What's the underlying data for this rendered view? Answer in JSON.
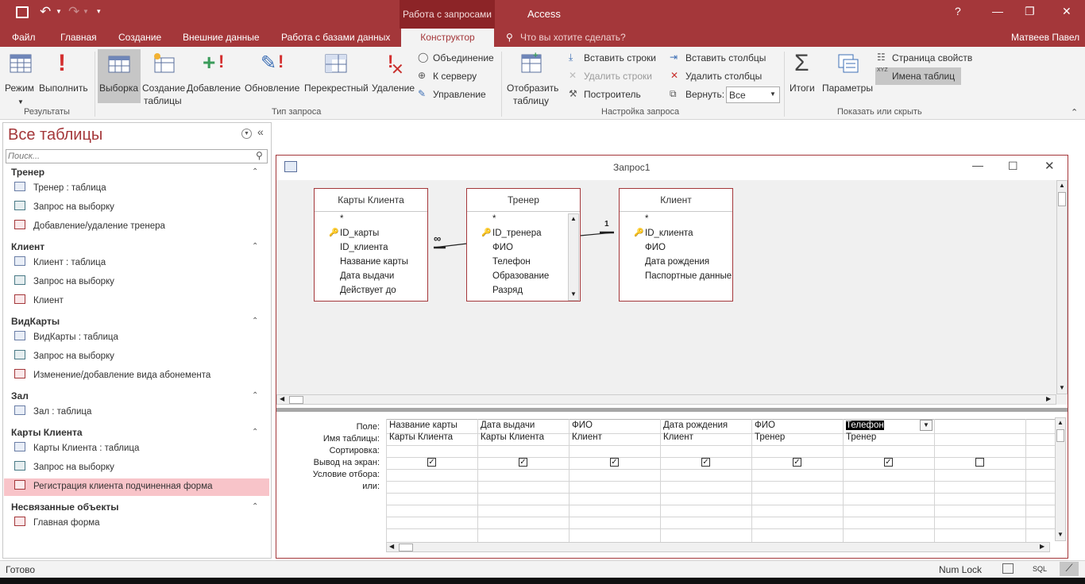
{
  "titlebar": {
    "context_tab": "Работа с запросами",
    "app_name": "Access",
    "help": "?"
  },
  "tabs": {
    "file": "Файл",
    "home": "Главная",
    "create": "Создание",
    "external": "Внешние данные",
    "db_tools": "Работа с базами данных",
    "designer": "Конструктор",
    "tell_me": "Что вы хотите сделать?",
    "user": "Матвеев Павел"
  },
  "ribbon": {
    "view": "Режим",
    "run": "Выполнить",
    "results_group": "Результаты",
    "select": "Выборка",
    "make_table_1": "Создание",
    "make_table_2": "таблицы",
    "append": "Добавление",
    "update": "Обновление",
    "crosstab": "Перекрестный",
    "delete": "Удаление",
    "union": "Объединение",
    "passthrough": "К серверу",
    "ddl": "Управление",
    "query_type_group": "Тип запроса",
    "show_table_1": "Отобразить",
    "show_table_2": "таблицу",
    "insert_rows": "Вставить строки",
    "delete_rows": "Удалить строки",
    "builder": "Построитель",
    "insert_cols": "Вставить столбцы",
    "delete_cols": "Удалить столбцы",
    "return_label": "Вернуть:",
    "return_value": "Все",
    "query_setup_group": "Настройка запроса",
    "totals": "Итоги",
    "parameters": "Параметры",
    "property_sheet": "Страница свойств",
    "table_names": "Имена таблиц",
    "xyz": "XYZ",
    "show_hide_group": "Показать или скрыть"
  },
  "nav": {
    "title": "Все таблицы",
    "search_placeholder": "Поиск...",
    "groups": [
      {
        "name": "Тренер",
        "items": [
          "Тренер : таблица",
          "Запрос на выборку",
          "Добавление/удаление тренера"
        ]
      },
      {
        "name": "Клиент",
        "items": [
          "Клиент : таблица",
          "Запрос на выборку",
          "Клиент"
        ]
      },
      {
        "name": "ВидКарты",
        "items": [
          "ВидКарты : таблица",
          "Запрос на выборку",
          "Изменение/добавление вида абонемента"
        ]
      },
      {
        "name": "Зал",
        "items": [
          "Зал : таблица"
        ]
      },
      {
        "name": "Карты Клиента",
        "items": [
          "Карты Клиента : таблица",
          "Запрос на выборку",
          "Регистрация клиента подчиненная форма"
        ]
      },
      {
        "name": "Несвязанные объекты",
        "items": [
          "Главная форма"
        ]
      }
    ]
  },
  "query": {
    "title": "Запрос1",
    "tables": [
      {
        "name": "Карты Клиента",
        "fields": [
          "*",
          "ID_карты",
          "ID_клиента",
          "Название карты",
          "Дата выдачи",
          "Действует до"
        ]
      },
      {
        "name": "Тренер",
        "fields": [
          "*",
          "ID_тренера",
          "ФИО",
          "Телефон",
          "Образование",
          "Разряд"
        ]
      },
      {
        "name": "Клиент",
        "fields": [
          "*",
          "ID_клиента",
          "ФИО",
          "Дата рождения",
          "Паспортные данные"
        ]
      }
    ],
    "rel_many": "∞",
    "rel_one": "1",
    "row_labels": [
      "Поле:",
      "Имя таблицы:",
      "Сортировка:",
      "Вывод на экран:",
      "Условие отбора:",
      "или:"
    ],
    "columns": [
      {
        "field": "Название карты",
        "table": "Карты Клиента",
        "show": true
      },
      {
        "field": "Дата выдачи",
        "table": "Карты Клиента",
        "show": true
      },
      {
        "field": "ФИО",
        "table": "Клиент",
        "show": true
      },
      {
        "field": "Дата рождения",
        "table": "Клиент",
        "show": true
      },
      {
        "field": "ФИО",
        "table": "Тренер",
        "show": true
      },
      {
        "field": "Телефон",
        "table": "Тренер",
        "show": true
      },
      {
        "field": "",
        "table": "",
        "show": false
      }
    ]
  },
  "status": {
    "ready": "Готово",
    "numlock": "Num Lock",
    "sql": "SQL"
  }
}
